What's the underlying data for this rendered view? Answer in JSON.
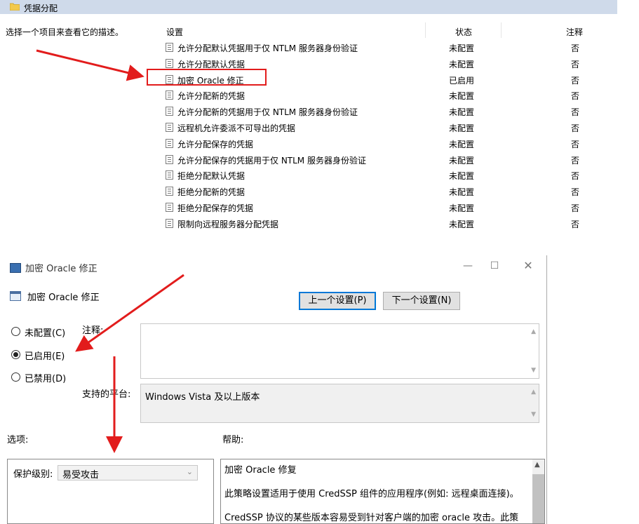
{
  "top_panel": {
    "folder_title": "凭据分配",
    "description_hint": "选择一个项目来查看它的描述。",
    "columns": {
      "setting": "设置",
      "state": "状态",
      "comment": "注释"
    },
    "rows": [
      {
        "name": "允许分配默认凭据用于仅 NTLM 服务器身份验证",
        "state": "未配置",
        "comment": "否"
      },
      {
        "name": "允许分配默认凭据",
        "state": "未配置",
        "comment": "否"
      },
      {
        "name": "加密 Oracle 修正",
        "state": "已启用",
        "comment": "否"
      },
      {
        "name": "允许分配新的凭据",
        "state": "未配置",
        "comment": "否"
      },
      {
        "name": "允许分配新的凭据用于仅 NTLM 服务器身份验证",
        "state": "未配置",
        "comment": "否"
      },
      {
        "name": "远程机允许委派不可导出的凭据",
        "state": "未配置",
        "comment": "否"
      },
      {
        "name": "允许分配保存的凭据",
        "state": "未配置",
        "comment": "否"
      },
      {
        "name": "允许分配保存的凭据用于仅 NTLM 服务器身份验证",
        "state": "未配置",
        "comment": "否"
      },
      {
        "name": "拒绝分配默认凭据",
        "state": "未配置",
        "comment": "否"
      },
      {
        "name": "拒绝分配新的凭据",
        "state": "未配置",
        "comment": "否"
      },
      {
        "name": "拒绝分配保存的凭据",
        "state": "未配置",
        "comment": "否"
      },
      {
        "name": "限制向远程服务器分配凭据",
        "state": "未配置",
        "comment": "否"
      }
    ]
  },
  "dialog": {
    "window_title": "加密 Oracle 修正",
    "window_controls": {
      "minimize": "—",
      "maximize": "☐",
      "close": "✕"
    },
    "setting_name": "加密 Oracle 修正",
    "prev_button": "上一个设置(P)",
    "next_button": "下一个设置(N)",
    "radio_options": [
      {
        "label": "未配置(C)",
        "checked": false
      },
      {
        "label": "已启用(E)",
        "checked": true
      },
      {
        "label": "已禁用(D)",
        "checked": false
      }
    ],
    "comment_label": "注释:",
    "platform_label": "支持的平台:",
    "platform_value": "Windows Vista 及以上版本",
    "options_label": "选项:",
    "help_label": "帮助:",
    "protection_level_label": "保护级别:",
    "protection_level_value": "易受攻击",
    "help_lines": [
      "加密 Oracle 修复",
      "此策略设置适用于使用 CredSSP 组件的应用程序(例如: 远程桌面连接)。",
      "CredSSP 协议的某些版本容易受到针对客户端的加密 oracle 攻击。此策"
    ]
  },
  "colors": {
    "header_bg": "#cfdaea",
    "annotation_red": "#e21c1c",
    "button_focus_blue": "#0078d7"
  }
}
